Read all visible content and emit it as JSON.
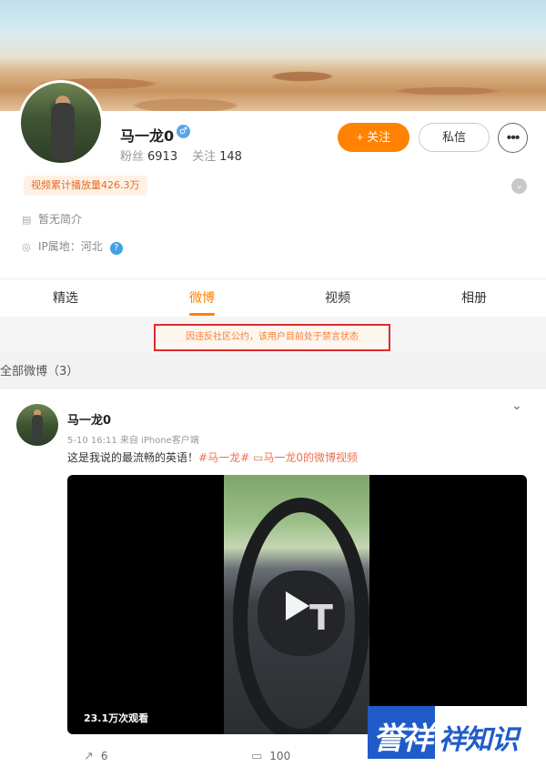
{
  "profile": {
    "name": "马一龙0",
    "gender_icon": "male-icon",
    "gender_glyph": "♂",
    "fans_label": "粉丝",
    "fans_count": "6913",
    "following_label": "关注",
    "following_count": "148",
    "follow_button": "+ 关注",
    "message_button": "私信",
    "more_glyph": "•••",
    "video_plays_badge": "视频累计播放量426.3万",
    "bio": "暂无简介",
    "ip_location": "IP属地：河北"
  },
  "tabs": [
    "精选",
    "微博",
    "视频",
    "相册"
  ],
  "active_tab": "微博",
  "notice": "因违反社区公约，该用户目前处于禁言状态",
  "section_title": "全部微博（3）",
  "post": {
    "author": "马一龙0",
    "meta": "5-10 16:11 来自 iPhone客户端",
    "text_prefix": "这是我说的最流畅的英语！",
    "hashtag": "#马一龙#",
    "video_link": "马一龙0的微博视频",
    "video_views": "23.1万次观看",
    "reposts": "6",
    "comments": "100"
  },
  "watermark": {
    "logo_text": "誉祥",
    "brand_text": "祥知识"
  },
  "colors": {
    "accent": "#ff8200",
    "notice_border": "#e02b2b",
    "notice_text": "#ff7a2a",
    "hashtag": "#eb7350",
    "watermark_blue": "#1f5cc9"
  }
}
